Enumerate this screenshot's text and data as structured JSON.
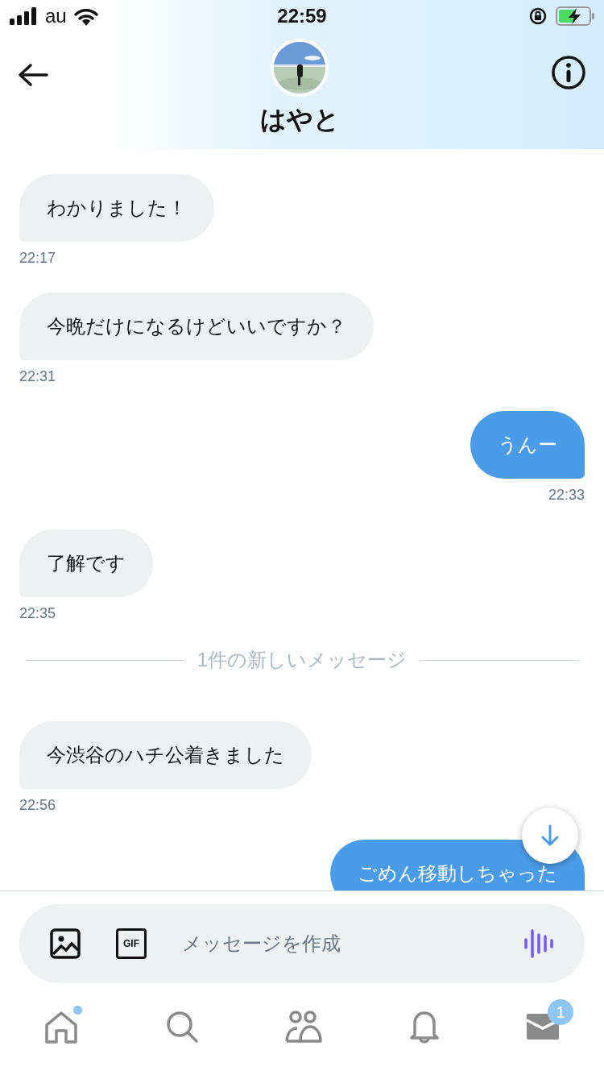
{
  "status_bar": {
    "carrier": "au",
    "time": "22:59"
  },
  "header": {
    "name": "はやと"
  },
  "messages": [
    {
      "kind": "received",
      "text": "わかりました！",
      "time": "22:17"
    },
    {
      "kind": "received",
      "text": "今晩だけになるけどいいですか？",
      "time": "22:31"
    },
    {
      "kind": "sent",
      "text": "うんー",
      "time": "22:33"
    },
    {
      "kind": "received",
      "text": "了解です",
      "time": "22:35"
    },
    {
      "kind": "divider",
      "text": "1件の新しいメッセージ"
    },
    {
      "kind": "received",
      "text": "今渋谷のハチ公着きました",
      "time": "22:56"
    },
    {
      "kind": "sent",
      "text": "ごめん移動しちゃった"
    }
  ],
  "composer": {
    "gif_label": "GIF",
    "placeholder": "メッセージを作成"
  },
  "tab_bar": [
    {
      "kind": "home",
      "dot": true
    },
    {
      "kind": "search",
      "dot": false
    },
    {
      "kind": "people",
      "dot": false
    },
    {
      "kind": "bell",
      "dot": false
    },
    {
      "kind": "mail",
      "dot": false,
      "badge": "1"
    }
  ]
}
